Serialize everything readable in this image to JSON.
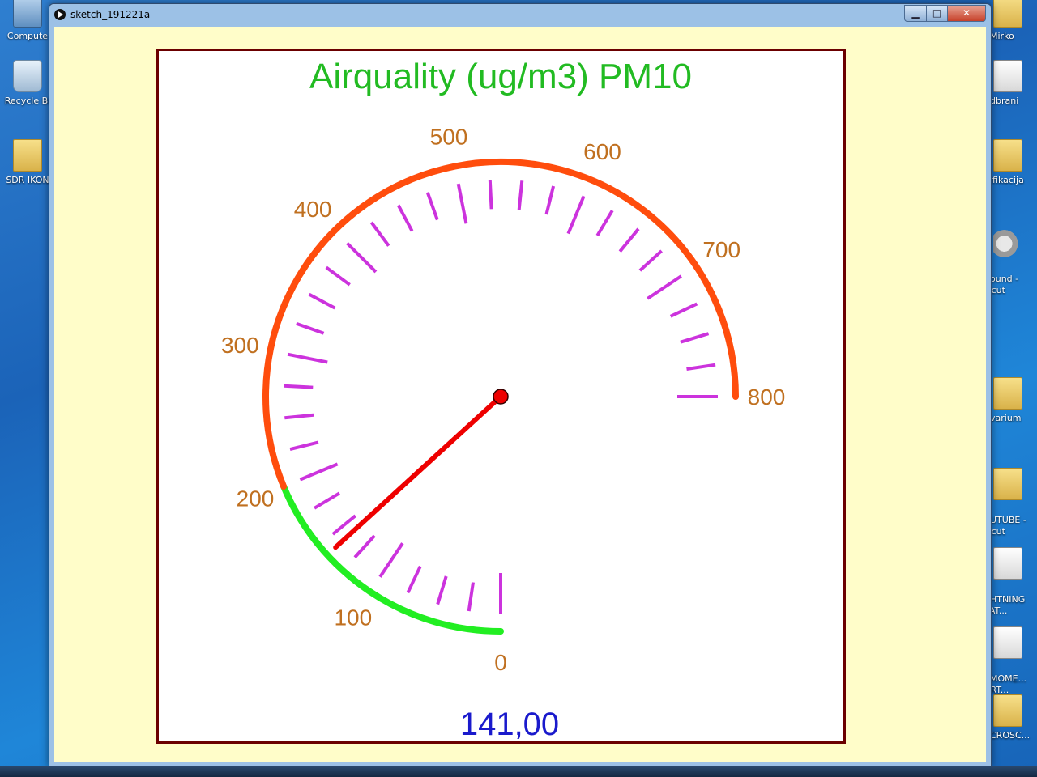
{
  "desktop": {
    "icons_left": [
      {
        "label": "Compute",
        "icon": "computer-icon"
      },
      {
        "label": "Recycle Bi",
        "icon": "recycle-bin-icon"
      },
      {
        "label": "SDR IKON",
        "icon": "folder-icon"
      }
    ],
    "icons_right": [
      {
        "label": "Mirko",
        "icon": "folder-icon"
      },
      {
        "label": "dbrani",
        "icon": "folder-icon"
      },
      {
        "label": "ifikacija",
        "icon": "folder-icon"
      },
      {
        "label": "ound -\nortcut",
        "icon": "speaker-icon"
      },
      {
        "label": "varium",
        "icon": "folder-icon"
      },
      {
        "label": "UTUBE -\nortcut",
        "icon": "folder-icon"
      },
      {
        "label": "HTNING\nSTAT...",
        "icon": "file-icon"
      },
      {
        "label": "MOME...\nEART...",
        "icon": "file-icon"
      },
      {
        "label": "CROSC...",
        "icon": "folder-icon"
      }
    ]
  },
  "window": {
    "title": "sketch_191221a",
    "minimize_symbol": "▁",
    "maximize_symbol": "□",
    "close_symbol": "✕"
  },
  "gauge": {
    "title": "Airquality (ug/m3) PM10",
    "min": 0,
    "max": 800,
    "value": 141,
    "value_text": "141,00",
    "green_until": 200,
    "major_labels": [
      "0",
      "100",
      "200",
      "300",
      "400",
      "500",
      "600",
      "700",
      "800"
    ],
    "colors": {
      "title": "#22bb22",
      "labels": "#c07020",
      "arc_high": "#ff4d0d",
      "arc_low": "#22ee22",
      "ticks": "#cc33dd",
      "needle": "#ee0000",
      "value_text": "#1a1acc",
      "border": "#6b0000"
    }
  }
}
